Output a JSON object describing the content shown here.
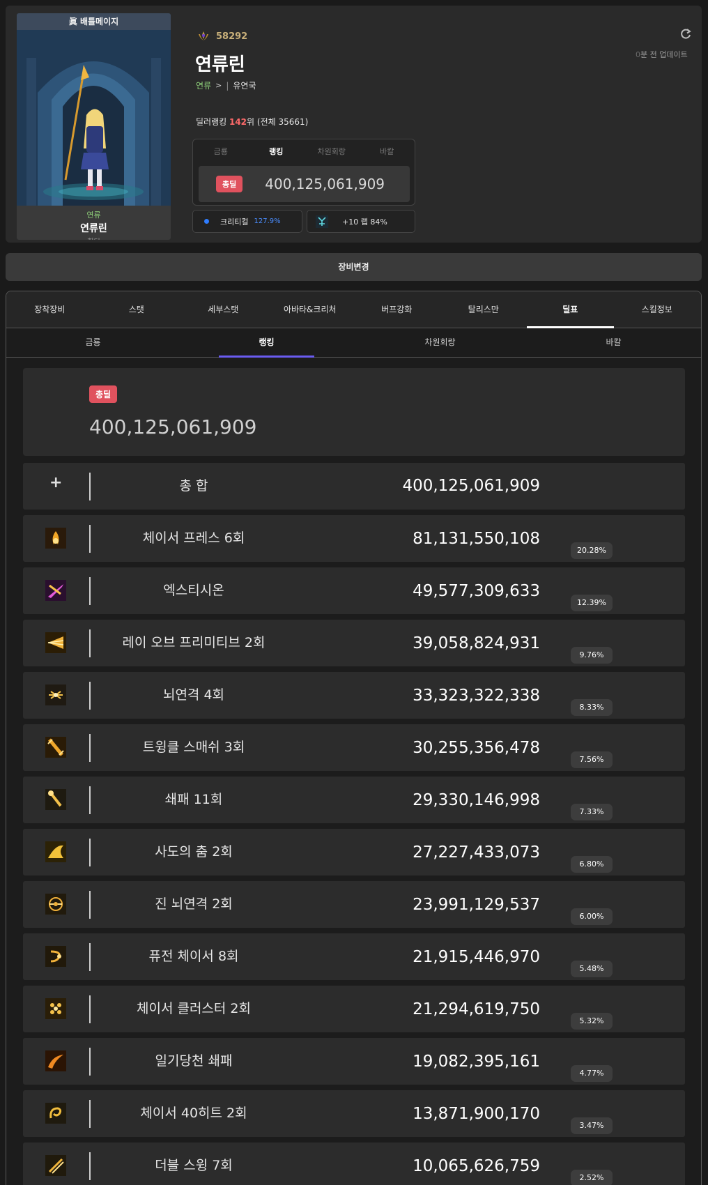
{
  "character_card": {
    "title": "眞 배틀메이지",
    "adventure": "연류",
    "name": "연류린",
    "job": "힐더"
  },
  "profile": {
    "fame": "58292",
    "name": "연류린",
    "adventure": "연류",
    "adventure_chevron": ">",
    "separator": "|",
    "guild": "유연국",
    "deal_rank_prefix": "딜러랭킹 ",
    "deal_rank_value": "142",
    "deal_rank_suffix": "위 (전체 35661)",
    "update_count": "0",
    "update_text": "분 전 업데이트"
  },
  "rank_box": {
    "tabs": [
      "금룡",
      "랭킹",
      "차원회랑",
      "바칼"
    ],
    "active_tab": 1,
    "badge": "총딜",
    "damage": "400,125,061,909"
  },
  "stat_chips": {
    "crit_label": "크리티컬",
    "crit_value": "127.9%",
    "enchant_label": "+10 랩 84%"
  },
  "equip_change_label": "장비변경",
  "main_tabs": [
    "장착장비",
    "스탯",
    "세부스탯",
    "아바타&크리처",
    "버프강화",
    "탈리스만",
    "딜표",
    "스킬정보"
  ],
  "main_active_tab": 6,
  "sub_tabs": [
    "금룡",
    "랭킹",
    "차원회랑",
    "바칼"
  ],
  "sub_active_tab": 1,
  "total": {
    "badge": "총딜",
    "value": "400,125,061,909"
  },
  "summary_row": {
    "plus": "+",
    "name": "총 합",
    "damage": "400,125,061,909"
  },
  "skills": [
    {
      "icon": "flame-burst-icon",
      "name": "체이서 프레스 6회",
      "damage": "81,131,550,108",
      "pct": "20.28%"
    },
    {
      "icon": "purple-slash-icon",
      "name": "엑스티시온",
      "damage": "49,577,309,633",
      "pct": "12.39%"
    },
    {
      "icon": "light-ray-icon",
      "name": "레이 오브 프리미티브 2회",
      "damage": "39,058,824,931",
      "pct": "9.76%"
    },
    {
      "icon": "lightning-strike-icon",
      "name": "뇌연격 4회",
      "damage": "33,323,322,338",
      "pct": "8.33%"
    },
    {
      "icon": "twinkle-smash-icon",
      "name": "트윙클 스매쉬 3회",
      "damage": "30,255,356,478",
      "pct": "7.56%"
    },
    {
      "icon": "staff-strike-icon",
      "name": "쇄패 11회",
      "damage": "29,330,146,998",
      "pct": "7.33%"
    },
    {
      "icon": "shadow-dance-icon",
      "name": "사도의 춤 2회",
      "damage": "27,227,433,073",
      "pct": "6.80%"
    },
    {
      "icon": "true-lightning-icon",
      "name": "진 뇌연격 2회",
      "damage": "23,991,129,537",
      "pct": "6.00%"
    },
    {
      "icon": "fusion-chaser-icon",
      "name": "퓨전 체이서 8회",
      "damage": "21,915,446,970",
      "pct": "5.48%"
    },
    {
      "icon": "chaser-cluster-icon",
      "name": "체이서 클러스터 2회",
      "damage": "21,294,619,750",
      "pct": "5.32%"
    },
    {
      "icon": "heaven-strike-icon",
      "name": "일기당천 쇄패",
      "damage": "19,082,395,161",
      "pct": "4.77%"
    },
    {
      "icon": "chaser-hits-icon",
      "name": "체이서 40히트 2회",
      "damage": "13,871,900,170",
      "pct": "3.47%"
    },
    {
      "icon": "double-swing-icon",
      "name": "더블 스윙 7회",
      "damage": "10,065,626,759",
      "pct": "2.52%"
    }
  ],
  "colors": {
    "accent_red": "#e0525e",
    "adventure_green": "#8fd17a",
    "crit_blue": "#4a8dff",
    "sub_tab_indicator": "#6a5cf0",
    "fame_gold": "#c9b07a"
  }
}
